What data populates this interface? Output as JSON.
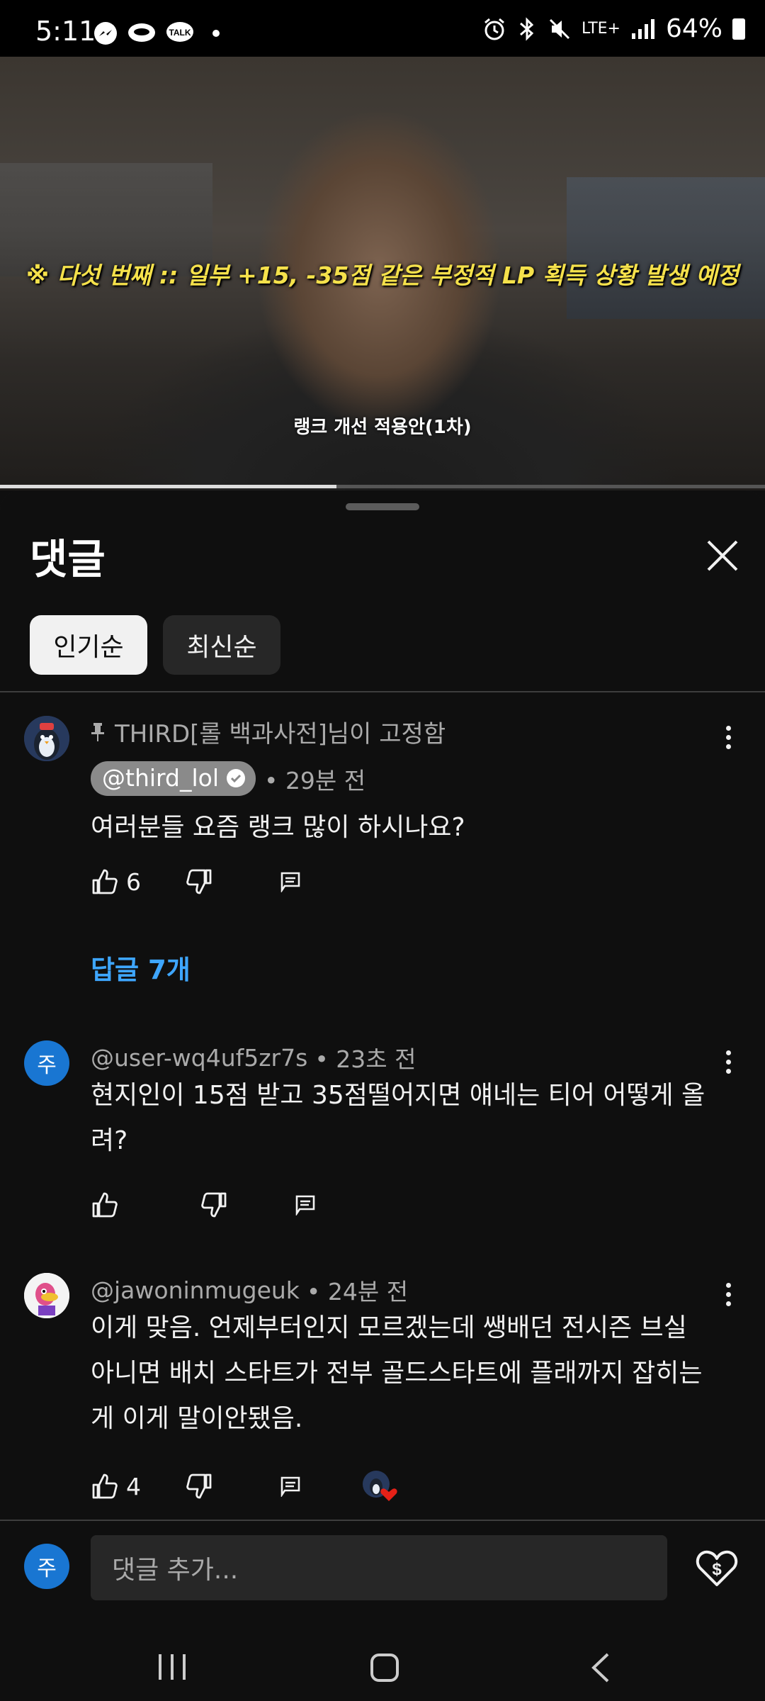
{
  "status_bar": {
    "time": "5:11",
    "left_icons": [
      "messenger-icon",
      "chat-bubble-icon",
      "talk-icon"
    ],
    "network": "LTE+",
    "battery": "64%"
  },
  "video": {
    "caption_main": "※ 다섯 번째 :: 일부 +15, -35점 같은 부정적 LP 획득 상황 발생 예정",
    "caption_sub": "랭크 개선 적용안(1차)",
    "progress_fraction": 0.44
  },
  "sheet": {
    "title": "댓글",
    "sort_chips": [
      "인기순",
      "최신순"
    ]
  },
  "comments": [
    {
      "pinned_text": "THIRD[롤 백과사전]님이 고정함",
      "author": "@third_lol",
      "verified": true,
      "time": "• 29분 전",
      "text": "여러분들 요즘 랭크 많이 하시나요?",
      "likes": "6",
      "replies": "답글 7개"
    },
    {
      "avatar_letter": "주",
      "author": "@user-wq4uf5zr7s",
      "time": "• 23초 전",
      "text": "현지인이 15점 받고 35점떨어지면 얘네는 티어 어떻게 올려?",
      "likes": ""
    },
    {
      "author": "@jawoninmugeuk",
      "time": "• 24분 전",
      "text": "이게 맞음. 언제부터인지 모르겠는데 쌩배던 전시즌 브실 아니면 배치 스타트가 전부 골드스타트에 플래까지 잡히는게 이게 말이안됐음.",
      "likes": "4",
      "creator_heart": true
    }
  ],
  "input": {
    "avatar_letter": "주",
    "placeholder": "댓글 추가..."
  },
  "colors": {
    "background": "#0f0f0f",
    "link_blue": "#3ea6ff",
    "avatar_blue": "#1976d2",
    "caption_yellow": "#f5e14b"
  }
}
